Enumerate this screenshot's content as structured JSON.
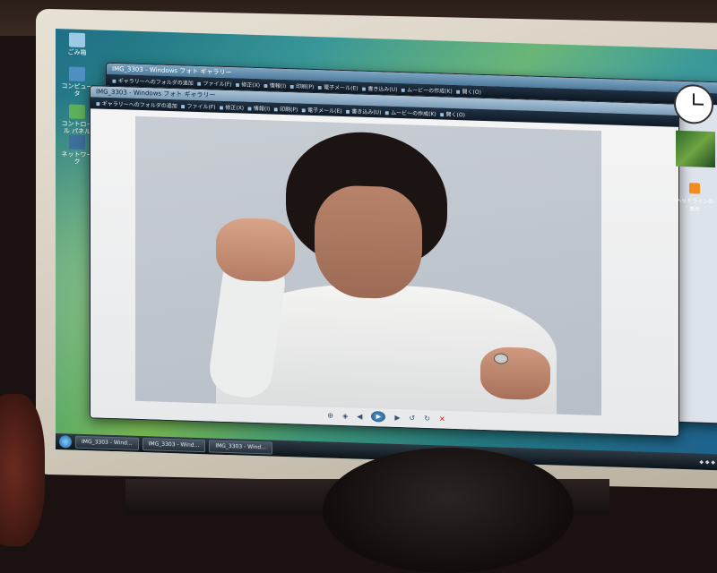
{
  "desktop": {
    "icons": [
      {
        "label": "ごみ箱"
      },
      {
        "label": "コンピュータ"
      },
      {
        "label": "コントロール パネル"
      },
      {
        "label": "ネットワーク"
      }
    ]
  },
  "back_window": {
    "title": "IMG_3303 - Windows フォト ギャラリー",
    "menu": [
      "ギャラリーへのフォルダの追加",
      "ファイル(F)",
      "修正(X)",
      "情報(I)",
      "印刷(P)",
      "電子メール(E)",
      "書き込み(U)",
      "ムービーの作成(K)",
      "開く(O)"
    ]
  },
  "front_window": {
    "title": "IMG_3303 - Windows フォト ギャラリー",
    "menu": [
      "ギャラリーへのフォルダの追加",
      "ファイル(F)",
      "修正(X)",
      "情報(I)",
      "印刷(P)",
      "電子メール(E)",
      "書き込み(U)",
      "ムービーの作成(K)",
      "開く(O)"
    ],
    "controls": [
      "zoom",
      "fit",
      "prev",
      "play",
      "next",
      "rotate-left",
      "rotate-right",
      "delete"
    ]
  },
  "taskbar": {
    "items": [
      "IMG_3303 - Wind...",
      "IMG_3303 - Wind...",
      "IMG_3303 - Wind..."
    ]
  },
  "sidebar": {
    "feed_label": "ヘッドラインの表示"
  },
  "colors": {
    "menubar": "#0f1a26",
    "taskbar": "#0d141a",
    "accent": "#4d7a9c"
  }
}
